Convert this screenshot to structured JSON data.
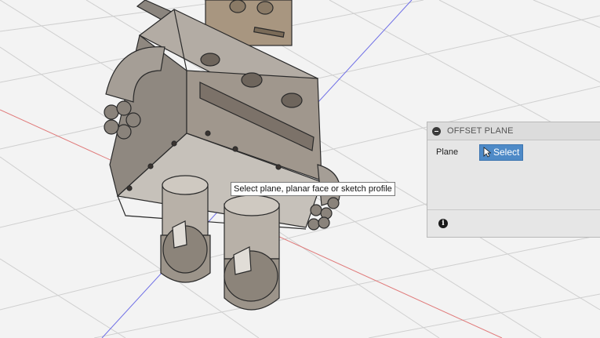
{
  "tooltip": {
    "text": "Select plane, planar face or sketch profile"
  },
  "panel": {
    "title": "OFFSET PLANE",
    "collapse_icon": "minus-circle-icon",
    "plane_label": "Plane",
    "select_label": "Select",
    "select_icon": "pointer-cursor-icon",
    "info_icon": "info-icon",
    "info_symbol": "i"
  },
  "colors": {
    "grid_line": "#cfcfcf",
    "background": "#f3f3f3",
    "x_axis": "#e07a7a",
    "y_axis": "#6f6fe6",
    "accent": "#4e8ac7",
    "model_body": "#a49b91",
    "model_edge": "#2a2a2a"
  },
  "viewport": {
    "model_description_icon": "robot-3d-model-icon"
  }
}
